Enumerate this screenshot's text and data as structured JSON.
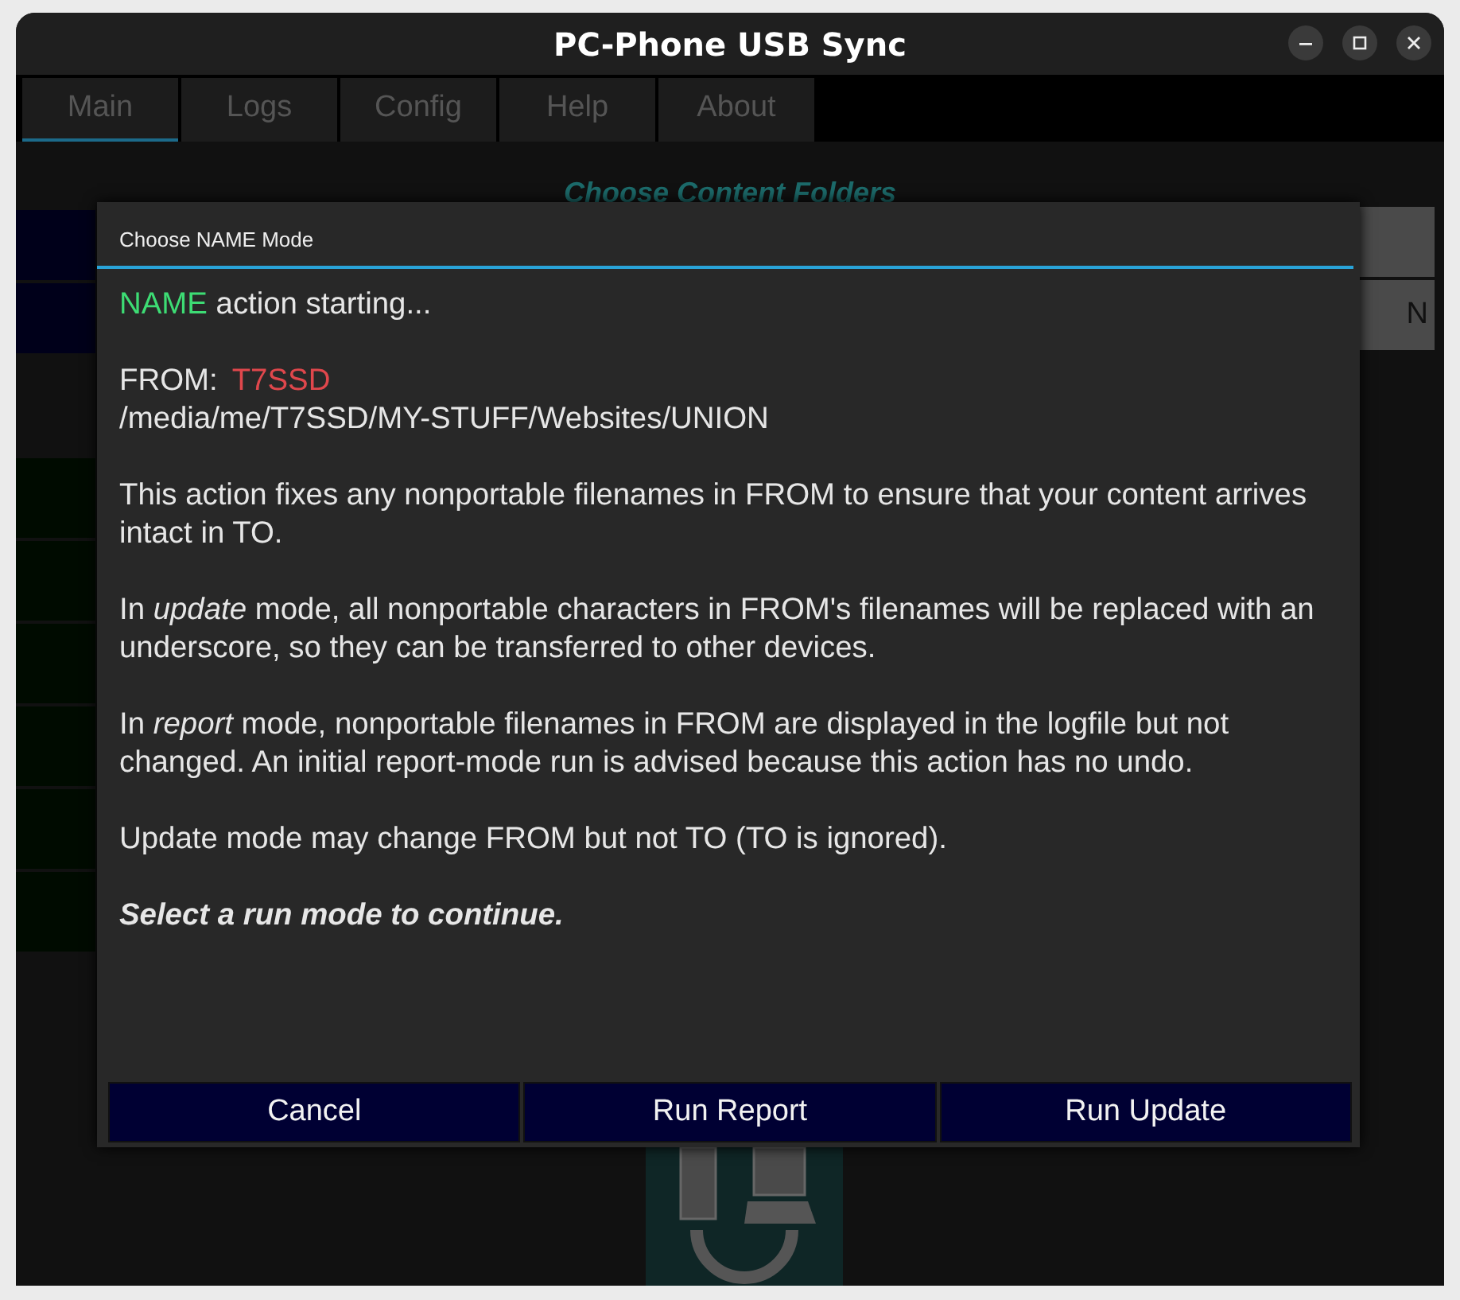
{
  "window": {
    "title": "PC-Phone USB Sync"
  },
  "tabs": [
    {
      "label": "Main",
      "selected": true
    },
    {
      "label": "Logs",
      "selected": false
    },
    {
      "label": "Config",
      "selected": false
    },
    {
      "label": "Help",
      "selected": false
    },
    {
      "label": "About",
      "selected": false
    }
  ],
  "background": {
    "heading": "Choose Content Folders",
    "side_button_label": "N"
  },
  "dialog": {
    "title": "Choose NAME Mode",
    "mode": "NAME",
    "mode_rest": " action starting...",
    "from_label": "FROM:",
    "from_device": "T7SSD",
    "from_path": "/media/me/T7SSD/MY-STUFF/Websites/UNION",
    "paragraphs": [
      "This action fixes any nonportable filenames in FROM to ensure that your content arrives intact in TO.",
      "In *update* mode, all nonportable characters in FROM's filenames will be replaced with an underscore, so they can be transferred to other devices.",
      "In *report* mode, nonportable filenames in FROM are displayed in the logfile but not changed.  An initial report-mode run is advised because this action has no undo.",
      "Update mode may change FROM but not TO (TO is ignored)."
    ],
    "prompt": "Select a run mode to continue.",
    "buttons": [
      "Cancel",
      "Run Report",
      "Run Update"
    ]
  }
}
